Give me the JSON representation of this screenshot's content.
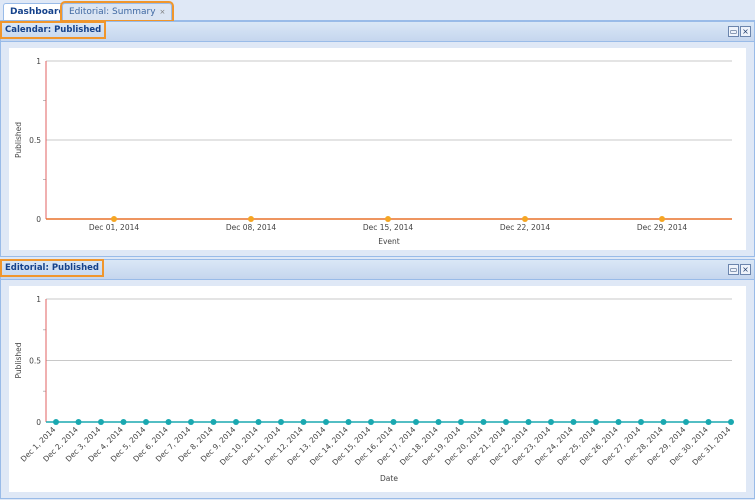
{
  "tabs": [
    {
      "label": "Dashboard",
      "active": true
    },
    {
      "label": "Editorial: Summary",
      "close": "×"
    }
  ],
  "panels": [
    {
      "title": "Calendar: Published",
      "tools": [
        "maximize-icon",
        "close-icon"
      ]
    },
    {
      "title": "Editorial: Published",
      "tools": [
        "maximize-icon",
        "close-icon"
      ]
    }
  ],
  "chart_data": [
    {
      "type": "line",
      "title": "Calendar: Published",
      "xlabel": "Event",
      "ylabel": "Published",
      "ylim": [
        0,
        1
      ],
      "yticks": [
        "0",
        "0.5",
        "1"
      ],
      "x": [
        "Dec 01, 2014",
        "Dec 08, 2014",
        "Dec 15, 2014",
        "Dec 22, 2014",
        "Dec 29, 2014"
      ],
      "values": [
        0,
        0,
        0,
        0,
        0
      ],
      "color": "#f5a623",
      "line_color": "#e8722c"
    },
    {
      "type": "line",
      "title": "Editorial: Published",
      "xlabel": "Date",
      "ylabel": "Published",
      "ylim": [
        0,
        1
      ],
      "yticks": [
        "0",
        "0.5",
        "1"
      ],
      "x": [
        "Dec 1, 2014",
        "Dec 2, 2014",
        "Dec 3, 2014",
        "Dec 4, 2014",
        "Dec 5, 2014",
        "Dec 6, 2014",
        "Dec 7, 2014",
        "Dec 8, 2014",
        "Dec 9, 2014",
        "Dec 10, 2014",
        "Dec 11, 2014",
        "Dec 12, 2014",
        "Dec 13, 2014",
        "Dec 14, 2014",
        "Dec 15, 2014",
        "Dec 16, 2014",
        "Dec 17, 2014",
        "Dec 18, 2014",
        "Dec 19, 2014",
        "Dec 20, 2014",
        "Dec 21, 2014",
        "Dec 22, 2014",
        "Dec 23, 2014",
        "Dec 24, 2014",
        "Dec 25, 2014",
        "Dec 26, 2014",
        "Dec 27, 2014",
        "Dec 28, 2014",
        "Dec 29, 2014",
        "Dec 30, 2014",
        "Dec 31, 2014"
      ],
      "values": [
        0,
        0,
        0,
        0,
        0,
        0,
        0,
        0,
        0,
        0,
        0,
        0,
        0,
        0,
        0,
        0,
        0,
        0,
        0,
        0,
        0,
        0,
        0,
        0,
        0,
        0,
        0,
        0,
        0,
        0,
        0
      ],
      "color": "#1aa8b0",
      "line_color": "#1aa8b0"
    }
  ]
}
